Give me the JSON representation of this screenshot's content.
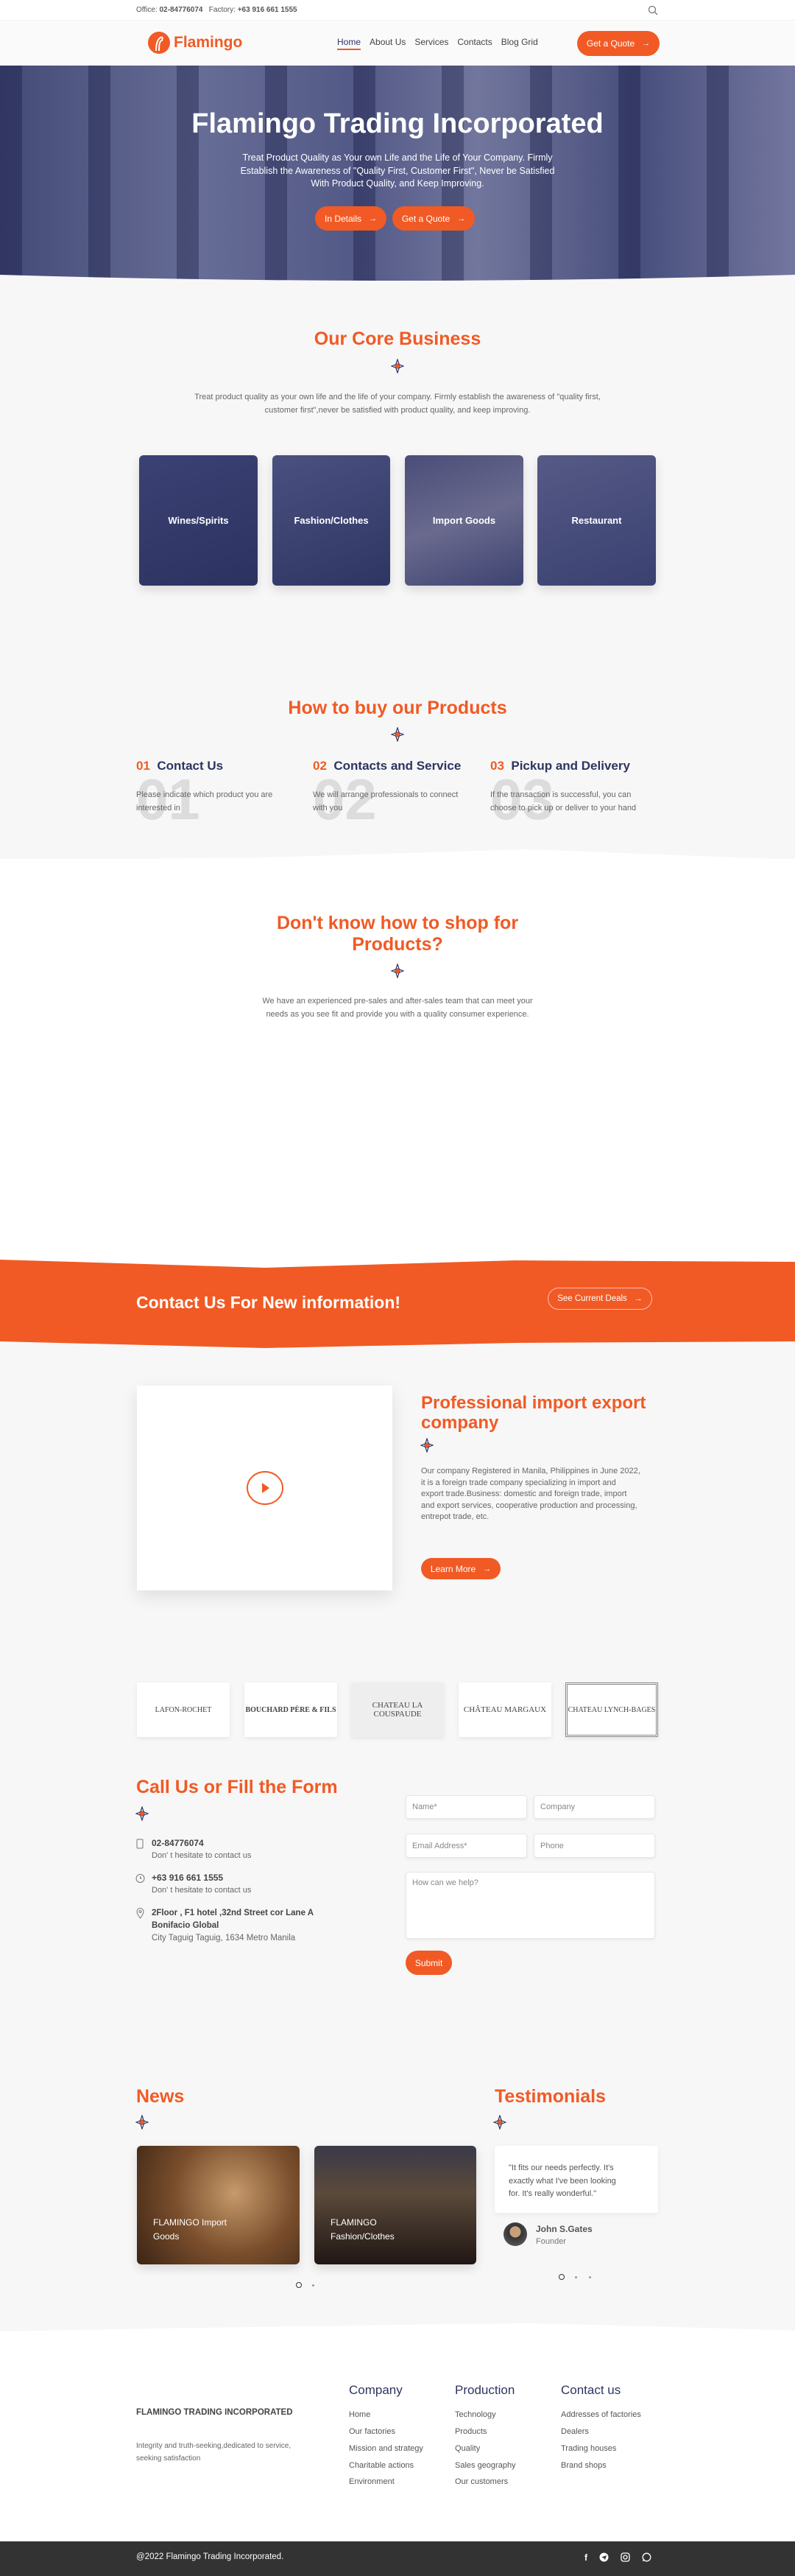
{
  "topbar": {
    "office_label": "Office:",
    "office_phone": "02-84776074",
    "factory_label": "Factory:",
    "factory_phone": "+63 916 661 1555",
    "search_icon": "search-icon"
  },
  "nav": {
    "logo_text": "Flamingo",
    "links": [
      "Home",
      "About Us",
      "Services",
      "Contacts",
      "Blog Grid"
    ],
    "active": "Home",
    "cta": "Get a Quote"
  },
  "hero": {
    "title": "Flamingo Trading Incorporated",
    "lines": [
      "Treat Product Quality as Your own Life and the Life of Your Company. Firmly",
      "Establish the Awareness of \"Quality First, Customer First\", Never be Satisfied",
      "With Product Quality, and Keep Improving."
    ],
    "btn1": "In Details",
    "btn2": "Get a Quote"
  },
  "core": {
    "title": "Our Core Business",
    "lines": [
      "Treat product quality as your own life and the life of your company. Firmly establish the awareness of \"quality first,",
      "customer first\",never be satisfied with product quality, and keep improving."
    ],
    "cards": [
      "Wines/Spirits",
      "Fashion/Clothes",
      "Import Goods",
      "Restaurant"
    ]
  },
  "howto": {
    "title": "How to buy our Products",
    "steps": [
      {
        "num": "01",
        "title": "Contact Us",
        "l1": "Please indicate which product you are",
        "l2": "interested in"
      },
      {
        "num": "02",
        "title": "Contacts and Service",
        "l1": "We will arrange professionals to connect",
        "l2": "with you"
      },
      {
        "num": "03",
        "title": "Pickup and Delivery",
        "l1": "If the transaction is successful, you can",
        "l2": "choose to pick up or deliver to your hand"
      }
    ]
  },
  "shop": {
    "title1": "Don't know how to shop for",
    "title2": "Products?",
    "l1": "We have an experienced pre-sales and after-sales team that can meet your",
    "l2": "needs as you see fit and provide you with a quality consumer experience."
  },
  "banner": {
    "text": "Contact Us For New information!",
    "button": "See Current Deals"
  },
  "about": {
    "title1": "Professional import export",
    "title2": "company",
    "lines": [
      "Our company Registered in Manila, Philippines in June 2022,",
      "it is a foreign trade company specializing in import and",
      "export trade.Business: domestic and foreign trade, import",
      "and export services, cooperative production and processing,",
      "entrepot trade, etc."
    ],
    "button": "Learn More"
  },
  "brands": [
    "LAFON-ROCHET",
    "BOUCHARD PÈRE & FILS",
    "CHATEAU LA COUSPAUDE",
    "CHÂTEAU MARGAUX",
    "CHATEAU LYNCH-BAGES"
  ],
  "contact": {
    "title": "Call Us or Fill the Form",
    "phone": "02-84776074",
    "phone_sub": "Don' t hesitate to contact us",
    "mobile": "+63 916 661 1555",
    "mobile_sub": "Don' t hesitate to contact us",
    "addr1": "2Floor , F1 hotel ,32nd Street cor Lane A",
    "addr2": "Bonifacio Global",
    "addr3": "City Taguig Taguig, 1634 Metro Manila",
    "form": {
      "name": "Name*",
      "company": "Company",
      "email": "Email Address*",
      "phone": "Phone",
      "message": "How can we help?",
      "submit": "Submit"
    }
  },
  "news": {
    "title": "News",
    "items": [
      {
        "l1": "FLAMINGO Import",
        "l2": "Goods"
      },
      {
        "l1": "FLAMINGO",
        "l2": "Fashion/Clothes"
      }
    ]
  },
  "testimonials": {
    "title": "Testimonials",
    "lines": [
      "\"It fits our needs perfectly. It's",
      "exactly what I've been looking",
      "for. It's really wonderful.\""
    ],
    "name": "John S.Gates",
    "role": "Founder"
  },
  "footer": {
    "company": "FLAMINGO TRADING INCORPORATED",
    "tag1": "Integrity and truth-seeking,dedicated to service,",
    "tag2": "seeking satisfaction",
    "cols": [
      {
        "title": "Company",
        "links": [
          "Home",
          "Our factories",
          "Mission and strategy",
          "Charitable actions",
          "Environment"
        ]
      },
      {
        "title": "Production",
        "links": [
          "Technology",
          "Products",
          "Quality",
          "Sales geography",
          "Our customers"
        ]
      },
      {
        "title": "Contact us",
        "links": [
          "Addresses of factories",
          "Dealers",
          "Trading houses",
          "Brand shops"
        ]
      }
    ],
    "copyright": "@2022 Flamingo Trading Incorporated.",
    "social": [
      "facebook-icon",
      "telegram-icon",
      "instagram-icon",
      "whatsapp-icon"
    ]
  },
  "colors": {
    "accent": "#f15a24",
    "navy": "#2d3561",
    "footer_bar": "#333333"
  }
}
